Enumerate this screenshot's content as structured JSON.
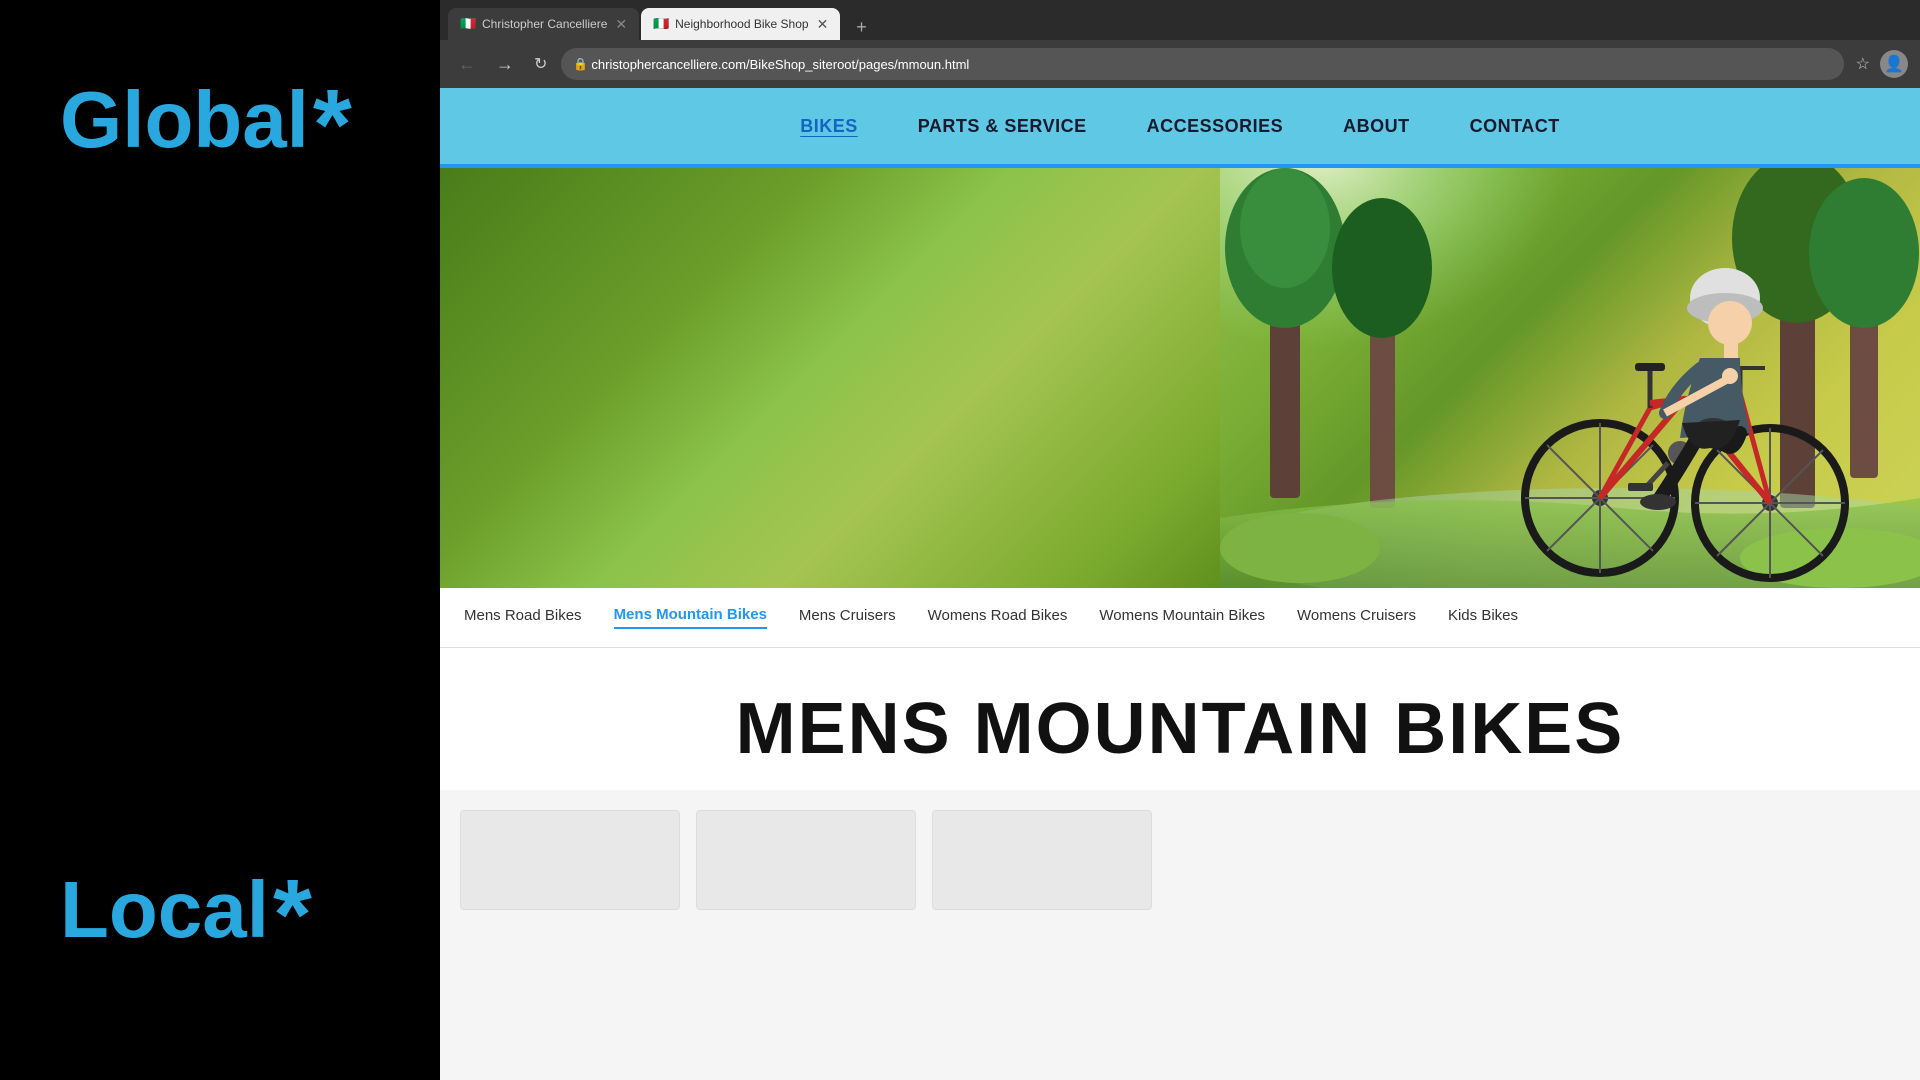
{
  "sidebar": {
    "global_label": "Global",
    "global_asterisk": "*",
    "local_label": "Local",
    "local_asterisk": "*"
  },
  "browser": {
    "tabs": [
      {
        "id": "tab1",
        "favicon": "🇮🇹",
        "label": "Christopher Cancelliere",
        "active": false
      },
      {
        "id": "tab2",
        "favicon": "🇮🇹",
        "label": "Neighborhood Bike Shop",
        "active": true
      }
    ],
    "url": "christophercancelliere.com/BikeShop_siteroot/pages/mmoun.html",
    "back_tooltip": "Back",
    "forward_tooltip": "Forward",
    "refresh_tooltip": "Refresh"
  },
  "website": {
    "nav": {
      "items": [
        {
          "id": "bikes",
          "label": "BIKES",
          "active": true
        },
        {
          "id": "parts",
          "label": "PARTS & SERVICE",
          "active": false
        },
        {
          "id": "accessories",
          "label": "ACCESSORIES",
          "active": false
        },
        {
          "id": "about",
          "label": "ABOUT",
          "active": false
        },
        {
          "id": "contact",
          "label": "CONTACT",
          "active": false
        }
      ]
    },
    "sub_nav": {
      "items": [
        {
          "id": "mens-road",
          "label": "Mens Road Bikes",
          "active": false
        },
        {
          "id": "mens-mountain",
          "label": "Mens Mountain Bikes",
          "active": true
        },
        {
          "id": "mens-cruisers",
          "label": "Mens Cruisers",
          "active": false
        },
        {
          "id": "womens-road",
          "label": "Womens Road Bikes",
          "active": false
        },
        {
          "id": "womens-mountain",
          "label": "Womens Mountain Bikes",
          "active": false
        },
        {
          "id": "womens-cruisers",
          "label": "Womens Cruisers",
          "active": false
        },
        {
          "id": "kids-bikes",
          "label": "Kids Bikes",
          "active": false
        }
      ]
    },
    "page_title": "MENS MOUNTAIN BIKES"
  }
}
